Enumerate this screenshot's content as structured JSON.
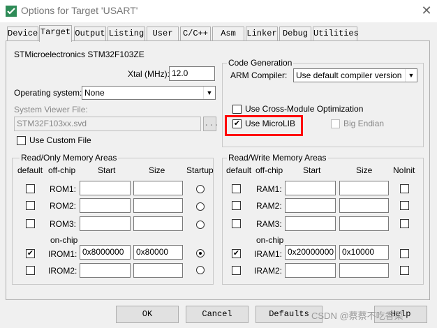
{
  "window": {
    "title": "Options for Target 'USART'",
    "close_glyph": "✕"
  },
  "tabs": [
    {
      "label": "Device"
    },
    {
      "label": "Target"
    },
    {
      "label": "Output"
    },
    {
      "label": "Listing"
    },
    {
      "label": "User"
    },
    {
      "label": "C/C++"
    },
    {
      "label": "Asm"
    },
    {
      "label": "Linker"
    },
    {
      "label": "Debug"
    },
    {
      "label": "Utilities"
    }
  ],
  "target": {
    "device_name": "STMicroelectronics STM32F103ZE",
    "xtal_label": "Xtal (MHz):",
    "xtal_value": "12.0",
    "os_label": "Operating system:",
    "os_value": "None",
    "svf_label": "System Viewer File:",
    "svf_value": "STM32F103xx.svd",
    "browse_label": "...",
    "custom_file_label": "Use Custom File",
    "custom_file_checked": false
  },
  "codegen": {
    "title": "Code Generation",
    "compiler_label": "ARM Compiler:",
    "compiler_value": "Use default compiler version",
    "cross_module_label": "Use Cross-Module Optimization",
    "cross_module_checked": false,
    "microlib_label": "Use MicroLIB",
    "microlib_checked": true,
    "big_endian_label": "Big Endian",
    "big_endian_checked": false
  },
  "rom": {
    "title": "Read/Only Memory Areas",
    "headers": {
      "default": "default",
      "offchip": "off-chip",
      "start": "Start",
      "size": "Size",
      "startup": "Startup"
    },
    "onchip_label": "on-chip",
    "rows": [
      {
        "label": "ROM1:",
        "start": "",
        "size": "",
        "default": false,
        "startup": false
      },
      {
        "label": "ROM2:",
        "start": "",
        "size": "",
        "default": false,
        "startup": false
      },
      {
        "label": "ROM3:",
        "start": "",
        "size": "",
        "default": false,
        "startup": false
      },
      {
        "label": "IROM1:",
        "start": "0x8000000",
        "size": "0x80000",
        "default": true,
        "startup": true
      },
      {
        "label": "IROM2:",
        "start": "",
        "size": "",
        "default": false,
        "startup": false
      }
    ]
  },
  "ram": {
    "title": "Read/Write Memory Areas",
    "headers": {
      "default": "default",
      "offchip": "off-chip",
      "start": "Start",
      "size": "Size",
      "noinit": "NoInit"
    },
    "onchip_label": "on-chip",
    "rows": [
      {
        "label": "RAM1:",
        "start": "",
        "size": "",
        "default": false,
        "noinit": false
      },
      {
        "label": "RAM2:",
        "start": "",
        "size": "",
        "default": false,
        "noinit": false
      },
      {
        "label": "RAM3:",
        "start": "",
        "size": "",
        "default": false,
        "noinit": false
      },
      {
        "label": "IRAM1:",
        "start": "0x20000000",
        "size": "0x10000",
        "default": true,
        "noinit": false
      },
      {
        "label": "IRAM2:",
        "start": "",
        "size": "",
        "default": false,
        "noinit": false
      }
    ]
  },
  "buttons": {
    "ok": "OK",
    "cancel": "Cancel",
    "defaults": "Defaults",
    "help": "Help"
  },
  "watermark": "CSDN @蔡蔡不吃香菜",
  "colors": {
    "highlight": "#ff0000",
    "dialog_bg": "#f0f0f0"
  }
}
